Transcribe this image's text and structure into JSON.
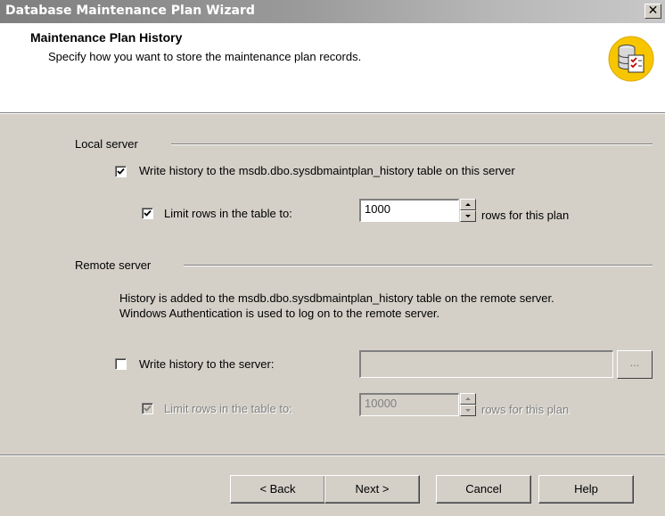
{
  "window": {
    "title": "Database Maintenance Plan Wizard",
    "close_symbol": "✕"
  },
  "header": {
    "title": "Maintenance Plan History",
    "subtitle": "Specify how you want to store the maintenance plan records.",
    "icon": "database-checklist-icon"
  },
  "local_server": {
    "group_label": "Local server",
    "write_history": {
      "label": "Write history to the msdb.dbo.sysdbmaintplan_history table on this server",
      "checked": true
    },
    "limit_rows": {
      "label": "Limit rows in the table to:",
      "checked": true,
      "value": "1000",
      "suffix": "rows for this plan"
    }
  },
  "remote_server": {
    "group_label": "Remote server",
    "info_line1": "History is added to the msdb.dbo.sysdbmaintplan_history table on the remote server.",
    "info_line2": "Windows Authentication is used to log on to the remote server.",
    "write_history": {
      "label": "Write history to the server:",
      "checked": false,
      "value": ""
    },
    "browse_label": "...",
    "limit_rows": {
      "label": "Limit rows in the table to:",
      "checked": true,
      "value": "10000",
      "suffix": "rows for this plan",
      "enabled": false
    }
  },
  "buttons": {
    "back": "< Back",
    "next": "Next >",
    "cancel": "Cancel",
    "help": "Help"
  }
}
